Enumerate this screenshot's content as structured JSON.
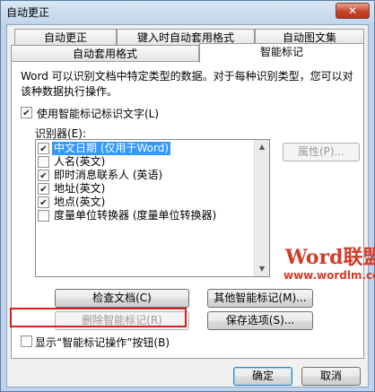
{
  "window": {
    "title": "自动更正",
    "close_label": "✕"
  },
  "tabs": {
    "row1": [
      "自动更正",
      "键入时自动套用格式",
      "自动图文集"
    ],
    "row2": [
      "自动套用格式",
      "智能标记"
    ],
    "active": "智能标记"
  },
  "panel": {
    "description": "Word 可以识别文档中特定类型的数据。对于每种识别类型，您可以对该种数据执行操作。",
    "use_smart_tags": {
      "label": "使用智能标记标识文字(L)",
      "checked": true
    },
    "recognizers_label": "识别器(E):",
    "recognizers": [
      {
        "label": "中文日期 (仅用于Word)",
        "checked": true,
        "selected": true
      },
      {
        "label": "人名(英文)",
        "checked": false,
        "selected": false
      },
      {
        "label": "即时消息联系人 (英语)",
        "checked": true,
        "selected": false
      },
      {
        "label": "地址(英文)",
        "checked": true,
        "selected": false
      },
      {
        "label": "地点(英文)",
        "checked": true,
        "selected": false
      },
      {
        "label": "度量单位转换器 (度量单位转换器)",
        "checked": false,
        "selected": false
      }
    ],
    "properties_button": "属性(P)...",
    "check_document_button": "检查文档(C)",
    "more_smart_tags_button": "其他智能标记(M)...",
    "remove_smart_tags_button": "删除智能标记(R)",
    "save_options_button": "保存选项(S)...",
    "show_actions_button": {
      "label": "显示“智能标记操作”按钮(B)",
      "checked": false
    }
  },
  "footer": {
    "ok_label": "确定",
    "cancel_label": "取消"
  },
  "watermark": {
    "brand": "Word联盟",
    "url": "www.wordlm.com"
  }
}
